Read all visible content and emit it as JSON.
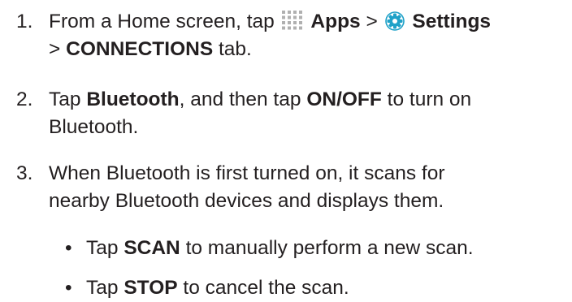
{
  "steps": [
    {
      "num": "1.",
      "pre": "From a Home screen, tap",
      "apps": "Apps",
      "sep": ">",
      "settings": "Settings",
      "line2_sep": ">",
      "connections": "CONNECTIONS",
      "line2_end": "tab."
    },
    {
      "num": "2.",
      "tap": "Tap",
      "bluetooth": "Bluetooth",
      "mid": ", and then tap",
      "onoff": "ON/OFF",
      "end": "to turn on",
      "line2": "Bluetooth."
    },
    {
      "num": "3.",
      "line1": "When Bluetooth is first turned on, it scans for",
      "line2": "nearby Bluetooth devices and displays them."
    }
  ],
  "bullets": [
    {
      "dot": "•",
      "tap": "Tap",
      "keyword": "SCAN",
      "rest": "to manually perform a new scan."
    },
    {
      "dot": "•",
      "tap": "Tap",
      "keyword": "STOP",
      "rest": "to cancel the scan."
    }
  ],
  "icons": {
    "apps": "apps-grid-icon",
    "settings": "settings-gear-icon"
  },
  "colors": {
    "text": "#231f20",
    "apps_icon": "#b0b0b0",
    "settings_icon": "#1ea1c8"
  }
}
